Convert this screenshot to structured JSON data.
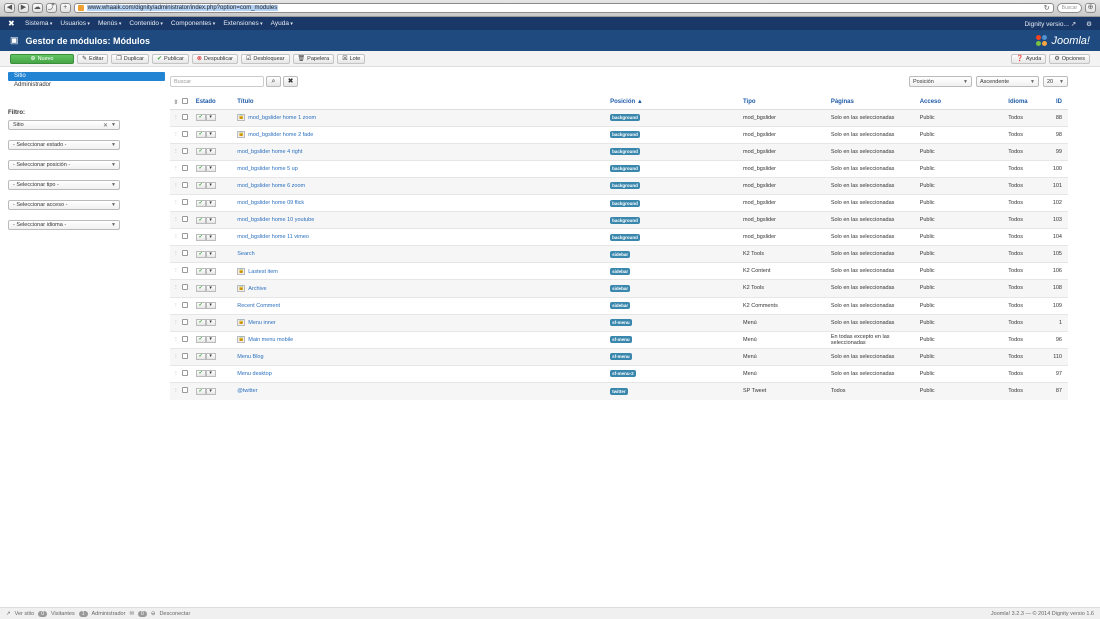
{
  "browser": {
    "url": "www.whaaik.com/dignity/administrator/index.php?option=com_modules",
    "search_placeholder": "Buscar"
  },
  "topnav": {
    "menu": [
      "Sistema",
      "Usuarios",
      "Menús",
      "Contenido",
      "Componentes",
      "Extensiones",
      "Ayuda"
    ],
    "site_link": "Dignity versio...",
    "settings": "⚙"
  },
  "header": {
    "title": "Gestor de módulos: Módulos",
    "brand": "Joomla!"
  },
  "toolbar": {
    "new": "Nuevo",
    "edit": "Editar",
    "duplicate": "Duplicar",
    "publish": "Publicar",
    "unpublish": "Despublicar",
    "unlock": "Desbloquear",
    "trash": "Papelera",
    "batch": "Lote",
    "help": "Ayuda",
    "options": "Opciones"
  },
  "sidebar": {
    "tabs": [
      "Sitio",
      "Administrador"
    ],
    "filter_title": "Filtro:",
    "filters": [
      "Sitio",
      "- Seleccionar estado -",
      "- Seleccionar posición -",
      "- Seleccionar tipo -",
      "- Seleccionar acceso -",
      "- Seleccionar idioma -"
    ]
  },
  "list": {
    "search_placeholder": "Buscar",
    "order_by": "Posición",
    "direction": "Ascendente",
    "limit": "20",
    "columns": [
      "Estado",
      "Título",
      "Posición",
      "Tipo",
      "Páginas",
      "Acceso",
      "Idioma",
      "ID"
    ],
    "rows": [
      {
        "title": "mod_bgslider home 1 zoom",
        "locked": true,
        "position": "background",
        "type": "mod_bgslider",
        "pages": "Solo en las seleccionadas",
        "access": "Public",
        "lang": "Todos",
        "id": "88"
      },
      {
        "title": "mod_bgslider home 2 fade",
        "locked": true,
        "position": "background",
        "type": "mod_bgslider",
        "pages": "Solo en las seleccionadas",
        "access": "Public",
        "lang": "Todos",
        "id": "98"
      },
      {
        "title": "mod_bgslider home 4 right",
        "locked": false,
        "position": "background",
        "type": "mod_bgslider",
        "pages": "Solo en las seleccionadas",
        "access": "Public",
        "lang": "Todos",
        "id": "99"
      },
      {
        "title": "mod_bgslider home 5 up",
        "locked": false,
        "position": "background",
        "type": "mod_bgslider",
        "pages": "Solo en las seleccionadas",
        "access": "Public",
        "lang": "Todos",
        "id": "100"
      },
      {
        "title": "mod_bgslider home 6 zoom",
        "locked": false,
        "position": "background",
        "type": "mod_bgslider",
        "pages": "Solo en las seleccionadas",
        "access": "Public",
        "lang": "Todos",
        "id": "101"
      },
      {
        "title": "mod_bgslider home 09 flick",
        "locked": false,
        "position": "background",
        "type": "mod_bgslider",
        "pages": "Solo en las seleccionadas",
        "access": "Public",
        "lang": "Todos",
        "id": "102"
      },
      {
        "title": "mod_bgslider home 10 youtube",
        "locked": false,
        "position": "background",
        "type": "mod_bgslider",
        "pages": "Solo en las seleccionadas",
        "access": "Public",
        "lang": "Todos",
        "id": "103"
      },
      {
        "title": "mod_bgslider home 11 vimeo",
        "locked": false,
        "position": "background",
        "type": "mod_bgslider",
        "pages": "Solo en las seleccionadas",
        "access": "Public",
        "lang": "Todos",
        "id": "104"
      },
      {
        "title": "Search",
        "locked": false,
        "position": "sidebar",
        "type": "K2 Tools",
        "pages": "Solo en las seleccionadas",
        "access": "Public",
        "lang": "Todos",
        "id": "105"
      },
      {
        "title": "Lastest item",
        "locked": true,
        "position": "sidebar",
        "type": "K2 Content",
        "pages": "Solo en las seleccionadas",
        "access": "Public",
        "lang": "Todos",
        "id": "106"
      },
      {
        "title": "Archive",
        "locked": true,
        "position": "sidebar",
        "type": "K2 Tools",
        "pages": "Solo en las seleccionadas",
        "access": "Public",
        "lang": "Todos",
        "id": "108"
      },
      {
        "title": "Recent Comment",
        "locked": false,
        "position": "sidebar",
        "type": "K2 Comments",
        "pages": "Solo en las seleccionadas",
        "access": "Public",
        "lang": "Todos",
        "id": "109"
      },
      {
        "title": "Menu inner",
        "locked": true,
        "position": "sf-menu",
        "type": "Menú",
        "pages": "Solo en las seleccionadas",
        "access": "Public",
        "lang": "Todos",
        "id": "1"
      },
      {
        "title": "Main menu mobile",
        "locked": true,
        "position": "sf-menu",
        "type": "Menú",
        "pages": "En todas excepto en las seleccionadas",
        "access": "Public",
        "lang": "Todos",
        "id": "96"
      },
      {
        "title": "Menu Blog",
        "locked": false,
        "position": "sf-menu",
        "type": "Menú",
        "pages": "Solo en las seleccionadas",
        "access": "Public",
        "lang": "Todos",
        "id": "110"
      },
      {
        "title": "Menu desktop",
        "locked": false,
        "position": "sf-menu-2",
        "type": "Menú",
        "pages": "Solo en las seleccionadas",
        "access": "Public",
        "lang": "Todos",
        "id": "97"
      },
      {
        "title": "@twitter",
        "locked": false,
        "position": "twitter",
        "type": "SP Tweet",
        "pages": "Todos",
        "access": "Public",
        "lang": "Todos",
        "id": "87"
      }
    ]
  },
  "footer": {
    "view_site": "Ver sitio",
    "visitors_count": "0",
    "visitors": "Visitantes",
    "admin_count": "1",
    "admin": "Administrador",
    "messages_count": "0",
    "logout": "Desconectar",
    "version": "Joomla! 3.2.3 — © 2014 Dignity versio 1.6"
  },
  "colors": {
    "topnav": "#1a3867",
    "header": "#1e4a7f",
    "accent": "#2384d3",
    "new_button": "#46a546",
    "badge": "#3a87ad"
  }
}
